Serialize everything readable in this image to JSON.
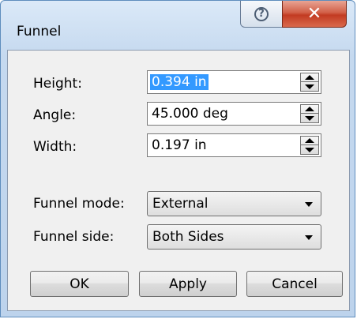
{
  "window": {
    "title": "Funnel"
  },
  "titlebar": {
    "help_glyph": "?",
    "close_glyph": "✕"
  },
  "fields": {
    "height": {
      "label": "Height:",
      "value": "0.394 in"
    },
    "angle": {
      "label": "Angle:",
      "value": "45.000 deg"
    },
    "width": {
      "label": "Width:",
      "value": "0.197 in"
    }
  },
  "dropdowns": {
    "funnel_mode": {
      "label": "Funnel mode:",
      "selected": "External"
    },
    "funnel_side": {
      "label": "Funnel side:",
      "selected": "Both Sides"
    }
  },
  "buttons": {
    "ok": "OK",
    "apply": "Apply",
    "cancel": "Cancel"
  },
  "colors": {
    "selection": "#3399ff",
    "close_button": "#c23b22",
    "frame": "#c5d9ef"
  }
}
